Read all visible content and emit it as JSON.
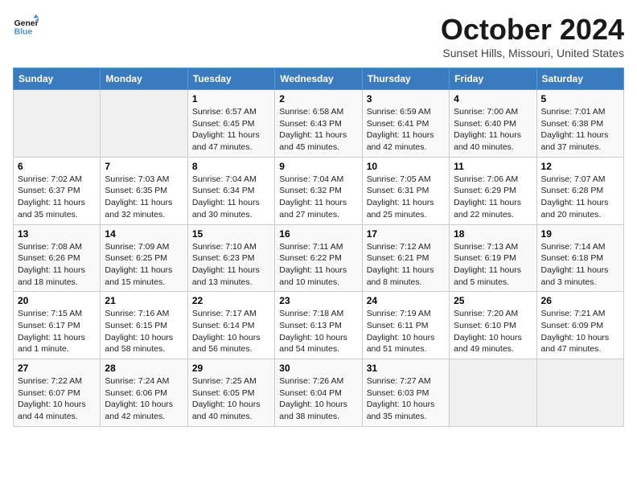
{
  "logo": {
    "line1": "General",
    "line2": "Blue"
  },
  "title": "October 2024",
  "subtitle": "Sunset Hills, Missouri, United States",
  "weekdays": [
    "Sunday",
    "Monday",
    "Tuesday",
    "Wednesday",
    "Thursday",
    "Friday",
    "Saturday"
  ],
  "weeks": [
    [
      {
        "day": "",
        "sunrise": "",
        "sunset": "",
        "daylight": ""
      },
      {
        "day": "",
        "sunrise": "",
        "sunset": "",
        "daylight": ""
      },
      {
        "day": "1",
        "sunrise": "Sunrise: 6:57 AM",
        "sunset": "Sunset: 6:45 PM",
        "daylight": "Daylight: 11 hours and 47 minutes."
      },
      {
        "day": "2",
        "sunrise": "Sunrise: 6:58 AM",
        "sunset": "Sunset: 6:43 PM",
        "daylight": "Daylight: 11 hours and 45 minutes."
      },
      {
        "day": "3",
        "sunrise": "Sunrise: 6:59 AM",
        "sunset": "Sunset: 6:41 PM",
        "daylight": "Daylight: 11 hours and 42 minutes."
      },
      {
        "day": "4",
        "sunrise": "Sunrise: 7:00 AM",
        "sunset": "Sunset: 6:40 PM",
        "daylight": "Daylight: 11 hours and 40 minutes."
      },
      {
        "day": "5",
        "sunrise": "Sunrise: 7:01 AM",
        "sunset": "Sunset: 6:38 PM",
        "daylight": "Daylight: 11 hours and 37 minutes."
      }
    ],
    [
      {
        "day": "6",
        "sunrise": "Sunrise: 7:02 AM",
        "sunset": "Sunset: 6:37 PM",
        "daylight": "Daylight: 11 hours and 35 minutes."
      },
      {
        "day": "7",
        "sunrise": "Sunrise: 7:03 AM",
        "sunset": "Sunset: 6:35 PM",
        "daylight": "Daylight: 11 hours and 32 minutes."
      },
      {
        "day": "8",
        "sunrise": "Sunrise: 7:04 AM",
        "sunset": "Sunset: 6:34 PM",
        "daylight": "Daylight: 11 hours and 30 minutes."
      },
      {
        "day": "9",
        "sunrise": "Sunrise: 7:04 AM",
        "sunset": "Sunset: 6:32 PM",
        "daylight": "Daylight: 11 hours and 27 minutes."
      },
      {
        "day": "10",
        "sunrise": "Sunrise: 7:05 AM",
        "sunset": "Sunset: 6:31 PM",
        "daylight": "Daylight: 11 hours and 25 minutes."
      },
      {
        "day": "11",
        "sunrise": "Sunrise: 7:06 AM",
        "sunset": "Sunset: 6:29 PM",
        "daylight": "Daylight: 11 hours and 22 minutes."
      },
      {
        "day": "12",
        "sunrise": "Sunrise: 7:07 AM",
        "sunset": "Sunset: 6:28 PM",
        "daylight": "Daylight: 11 hours and 20 minutes."
      }
    ],
    [
      {
        "day": "13",
        "sunrise": "Sunrise: 7:08 AM",
        "sunset": "Sunset: 6:26 PM",
        "daylight": "Daylight: 11 hours and 18 minutes."
      },
      {
        "day": "14",
        "sunrise": "Sunrise: 7:09 AM",
        "sunset": "Sunset: 6:25 PM",
        "daylight": "Daylight: 11 hours and 15 minutes."
      },
      {
        "day": "15",
        "sunrise": "Sunrise: 7:10 AM",
        "sunset": "Sunset: 6:23 PM",
        "daylight": "Daylight: 11 hours and 13 minutes."
      },
      {
        "day": "16",
        "sunrise": "Sunrise: 7:11 AM",
        "sunset": "Sunset: 6:22 PM",
        "daylight": "Daylight: 11 hours and 10 minutes."
      },
      {
        "day": "17",
        "sunrise": "Sunrise: 7:12 AM",
        "sunset": "Sunset: 6:21 PM",
        "daylight": "Daylight: 11 hours and 8 minutes."
      },
      {
        "day": "18",
        "sunrise": "Sunrise: 7:13 AM",
        "sunset": "Sunset: 6:19 PM",
        "daylight": "Daylight: 11 hours and 5 minutes."
      },
      {
        "day": "19",
        "sunrise": "Sunrise: 7:14 AM",
        "sunset": "Sunset: 6:18 PM",
        "daylight": "Daylight: 11 hours and 3 minutes."
      }
    ],
    [
      {
        "day": "20",
        "sunrise": "Sunrise: 7:15 AM",
        "sunset": "Sunset: 6:17 PM",
        "daylight": "Daylight: 11 hours and 1 minute."
      },
      {
        "day": "21",
        "sunrise": "Sunrise: 7:16 AM",
        "sunset": "Sunset: 6:15 PM",
        "daylight": "Daylight: 10 hours and 58 minutes."
      },
      {
        "day": "22",
        "sunrise": "Sunrise: 7:17 AM",
        "sunset": "Sunset: 6:14 PM",
        "daylight": "Daylight: 10 hours and 56 minutes."
      },
      {
        "day": "23",
        "sunrise": "Sunrise: 7:18 AM",
        "sunset": "Sunset: 6:13 PM",
        "daylight": "Daylight: 10 hours and 54 minutes."
      },
      {
        "day": "24",
        "sunrise": "Sunrise: 7:19 AM",
        "sunset": "Sunset: 6:11 PM",
        "daylight": "Daylight: 10 hours and 51 minutes."
      },
      {
        "day": "25",
        "sunrise": "Sunrise: 7:20 AM",
        "sunset": "Sunset: 6:10 PM",
        "daylight": "Daylight: 10 hours and 49 minutes."
      },
      {
        "day": "26",
        "sunrise": "Sunrise: 7:21 AM",
        "sunset": "Sunset: 6:09 PM",
        "daylight": "Daylight: 10 hours and 47 minutes."
      }
    ],
    [
      {
        "day": "27",
        "sunrise": "Sunrise: 7:22 AM",
        "sunset": "Sunset: 6:07 PM",
        "daylight": "Daylight: 10 hours and 44 minutes."
      },
      {
        "day": "28",
        "sunrise": "Sunrise: 7:24 AM",
        "sunset": "Sunset: 6:06 PM",
        "daylight": "Daylight: 10 hours and 42 minutes."
      },
      {
        "day": "29",
        "sunrise": "Sunrise: 7:25 AM",
        "sunset": "Sunset: 6:05 PM",
        "daylight": "Daylight: 10 hours and 40 minutes."
      },
      {
        "day": "30",
        "sunrise": "Sunrise: 7:26 AM",
        "sunset": "Sunset: 6:04 PM",
        "daylight": "Daylight: 10 hours and 38 minutes."
      },
      {
        "day": "31",
        "sunrise": "Sunrise: 7:27 AM",
        "sunset": "Sunset: 6:03 PM",
        "daylight": "Daylight: 10 hours and 35 minutes."
      },
      {
        "day": "",
        "sunrise": "",
        "sunset": "",
        "daylight": ""
      },
      {
        "day": "",
        "sunrise": "",
        "sunset": "",
        "daylight": ""
      }
    ]
  ]
}
